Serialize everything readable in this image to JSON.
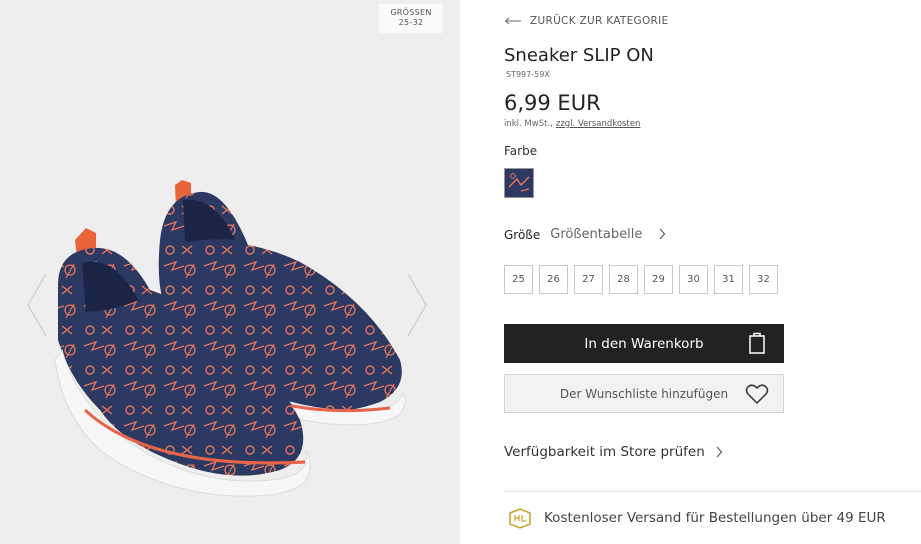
{
  "gallery": {
    "size_badge": {
      "line1": "GRÖSSEN",
      "line2": "25-32"
    },
    "prev_icon": "chevron-left-icon",
    "next_icon": "chevron-right-icon"
  },
  "product": {
    "back_label": "ZURÜCK ZUR KATEGORIE",
    "title": "Sneaker SLIP ON",
    "sku": "ST997-59X",
    "price": "6,99 EUR",
    "tax_prefix": "inkl. MwSt.,",
    "shipping_link": "zzgl. Versandkosten",
    "color_label": "Farbe",
    "size_label": "Größe",
    "size_table": "Größentabelle",
    "sizes": [
      "25",
      "26",
      "27",
      "28",
      "29",
      "30",
      "31",
      "32"
    ],
    "add_to_cart": "In den Warenkorb",
    "add_to_wishlist": "Der Wunschliste hinzufügen",
    "store_availability": "Verfügbarkeit im Store prüfen",
    "free_shipping": "Kostenloser Versand für Bestellungen über 49 EUR"
  },
  "colors": {
    "shoe_navy": "#2c3a63",
    "shoe_print": "#e8745a",
    "cart_bg": "#222222",
    "gallery_bg": "#eeeeee",
    "shipping_icon": "#c9a227"
  }
}
